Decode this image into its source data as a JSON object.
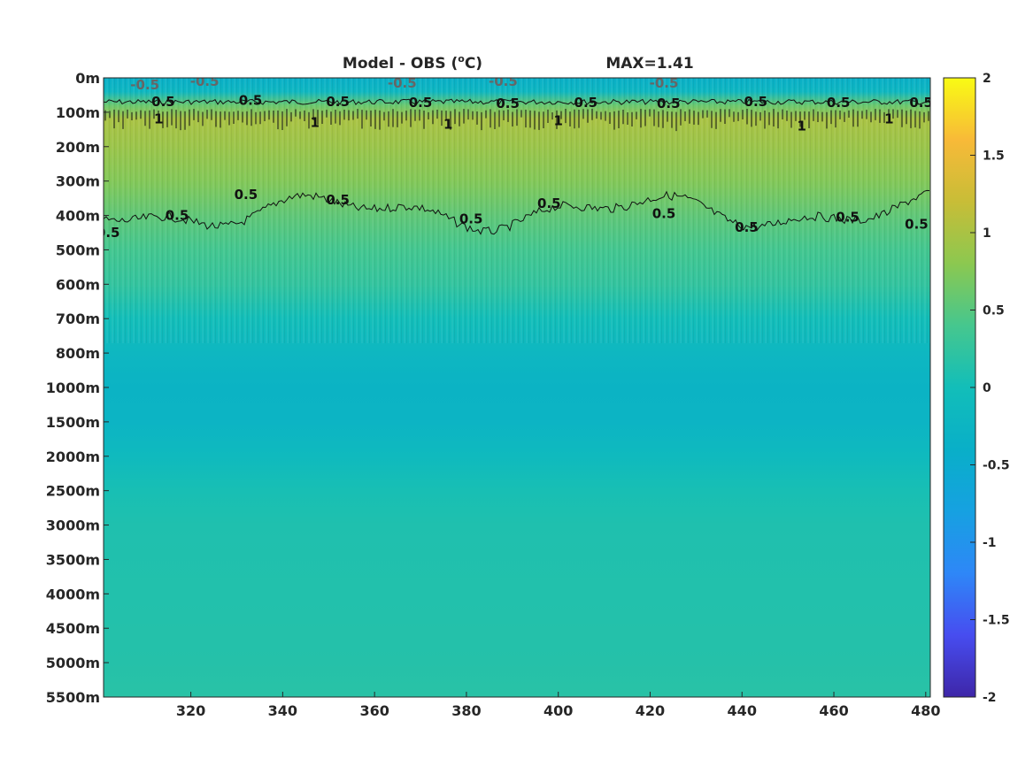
{
  "chart_data": {
    "type": "heatmap",
    "title": "Model - OBS (",
    "title_unit_sup": "o",
    "title_unit": "C)",
    "max_label": "MAX=1.41",
    "x_ticks": [
      320,
      340,
      360,
      380,
      400,
      420,
      440,
      460,
      480
    ],
    "xlim": [
      301,
      481
    ],
    "y_ticks": [
      "0m",
      "100m",
      "200m",
      "300m",
      "400m",
      "500m",
      "600m",
      "700m",
      "800m",
      "1000m",
      "1500m",
      "2000m",
      "2500m",
      "3000m",
      "3500m",
      "4000m",
      "4500m",
      "5000m",
      "5500m"
    ],
    "colorbar": {
      "ticks": [
        "2",
        "1.5",
        "1",
        "0.5",
        "0",
        "-0.5",
        "-1",
        "-1.5",
        "-2"
      ],
      "range": [
        -2,
        2
      ],
      "colormap": "parula"
    },
    "depth_profile": [
      {
        "depth_index": 0,
        "value": -0.4
      },
      {
        "depth_index": 0.4,
        "value": -0.2
      },
      {
        "depth_index": 0.8,
        "value": 0.6
      },
      {
        "depth_index": 1.2,
        "value": 1.0
      },
      {
        "depth_index": 2.0,
        "value": 0.9
      },
      {
        "depth_index": 3.0,
        "value": 0.75
      },
      {
        "depth_index": 4.0,
        "value": 0.55
      },
      {
        "depth_index": 5.0,
        "value": 0.38
      },
      {
        "depth_index": 6.0,
        "value": 0.25
      },
      {
        "depth_index": 7.0,
        "value": 0.0
      },
      {
        "depth_index": 8.0,
        "value": -0.2
      },
      {
        "depth_index": 9.0,
        "value": -0.3
      },
      {
        "depth_index": 10.0,
        "value": -0.28
      },
      {
        "depth_index": 11.0,
        "value": -0.12
      },
      {
        "depth_index": 12.0,
        "value": 0.05
      },
      {
        "depth_index": 13.0,
        "value": 0.1
      },
      {
        "depth_index": 15.0,
        "value": 0.12
      },
      {
        "depth_index": 17.0,
        "value": 0.15
      },
      {
        "depth_index": 18.0,
        "value": 0.18
      }
    ],
    "contour_labels": [
      {
        "text": "-0.5",
        "x": 310,
        "depth_index": 0.2
      },
      {
        "text": "-0.5",
        "x": 323,
        "depth_index": 0.1
      },
      {
        "text": "-0.5",
        "x": 366,
        "depth_index": 0.15
      },
      {
        "text": "-0.5",
        "x": 388,
        "depth_index": 0.1
      },
      {
        "text": "-0.5",
        "x": 423,
        "depth_index": 0.15
      },
      {
        "text": "0.5",
        "x": 314,
        "depth_index": 0.7
      },
      {
        "text": "0.5",
        "x": 333,
        "depth_index": 0.65
      },
      {
        "text": "0.5",
        "x": 352,
        "depth_index": 0.7
      },
      {
        "text": "0.5",
        "x": 370,
        "depth_index": 0.72
      },
      {
        "text": "0.5",
        "x": 389,
        "depth_index": 0.75
      },
      {
        "text": "0.5",
        "x": 406,
        "depth_index": 0.72
      },
      {
        "text": "0.5",
        "x": 424,
        "depth_index": 0.75
      },
      {
        "text": "0.5",
        "x": 443,
        "depth_index": 0.7
      },
      {
        "text": "0.5",
        "x": 461,
        "depth_index": 0.72
      },
      {
        "text": "0.5",
        "x": 479,
        "depth_index": 0.72
      },
      {
        "text": "1",
        "x": 313,
        "depth_index": 1.2
      },
      {
        "text": "1",
        "x": 347,
        "depth_index": 1.3
      },
      {
        "text": "1",
        "x": 376,
        "depth_index": 1.35
      },
      {
        "text": "1",
        "x": 400,
        "depth_index": 1.25
      },
      {
        "text": "1",
        "x": 453,
        "depth_index": 1.4
      },
      {
        "text": "1",
        "x": 472,
        "depth_index": 1.2
      },
      {
        "text": "0.5",
        "x": 302,
        "depth_index": 4.5
      },
      {
        "text": "0.5",
        "x": 317,
        "depth_index": 4.0
      },
      {
        "text": "0.5",
        "x": 332,
        "depth_index": 3.4
      },
      {
        "text": "0.5",
        "x": 352,
        "depth_index": 3.55
      },
      {
        "text": "0.5",
        "x": 381,
        "depth_index": 4.1
      },
      {
        "text": "0.5",
        "x": 398,
        "depth_index": 3.65
      },
      {
        "text": "0.5",
        "x": 423,
        "depth_index": 3.95
      },
      {
        "text": "0.5",
        "x": 441,
        "depth_index": 4.35
      },
      {
        "text": "0.5",
        "x": 463,
        "depth_index": 4.05
      },
      {
        "text": "0.5",
        "x": 478,
        "depth_index": 4.25
      }
    ]
  }
}
